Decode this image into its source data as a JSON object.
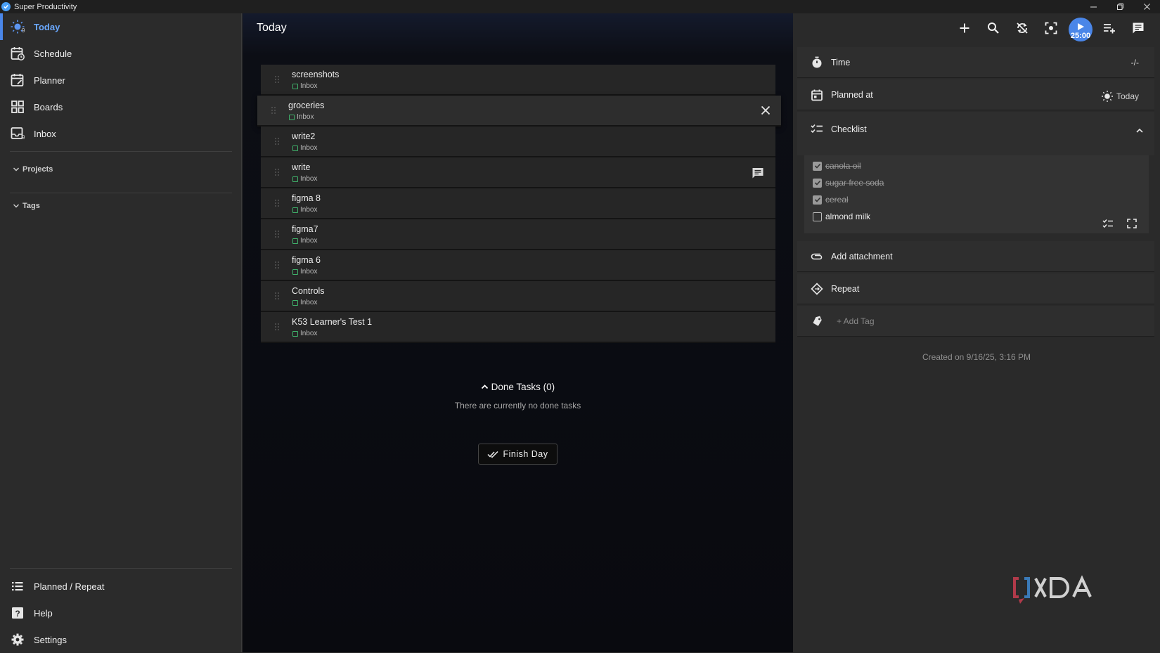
{
  "window": {
    "title": "Super Productivity"
  },
  "sidebar": {
    "nav": [
      {
        "label": "Today",
        "badge": "9",
        "icon": "sun-icon"
      },
      {
        "label": "Schedule",
        "icon": "schedule-icon"
      },
      {
        "label": "Planner",
        "icon": "planner-icon"
      },
      {
        "label": "Boards",
        "icon": "boards-icon"
      },
      {
        "label": "Inbox",
        "badge": "9",
        "icon": "inbox-icon"
      }
    ],
    "sections": {
      "projects": "Projects",
      "tags": "Tags"
    },
    "bottom": [
      {
        "label": "Planned / Repeat",
        "icon": "list-icon"
      },
      {
        "label": "Help",
        "icon": "help-icon"
      },
      {
        "label": "Settings",
        "icon": "gear-icon"
      }
    ]
  },
  "main": {
    "title": "Today",
    "tasks": [
      {
        "title": "screenshots",
        "tag": "Inbox"
      },
      {
        "title": "groceries",
        "tag": "Inbox"
      },
      {
        "title": "write2",
        "tag": "Inbox"
      },
      {
        "title": "write",
        "tag": "Inbox"
      },
      {
        "title": "figma 8",
        "tag": "Inbox"
      },
      {
        "title": "figma7",
        "tag": "Inbox"
      },
      {
        "title": "figma 6",
        "tag": "Inbox"
      },
      {
        "title": "Controls",
        "tag": "Inbox"
      },
      {
        "title": "K53 Learner's Test 1",
        "tag": "Inbox"
      }
    ],
    "done_title": "Done Tasks (0)",
    "done_empty": "There are currently no done tasks",
    "finish_day": "Finish Day"
  },
  "toolbar": {
    "timer": "25:00"
  },
  "detail": {
    "time_label": "Time",
    "time_value": "-/-",
    "planned_label": "Planned at",
    "planned_value": "Today",
    "checklist_label": "Checklist",
    "checklist": [
      {
        "text": "canola oil",
        "done": true
      },
      {
        "text": "sugar free soda",
        "done": true
      },
      {
        "text": "cereal",
        "done": true
      },
      {
        "text": "almond milk",
        "done": false
      }
    ],
    "attachment_label": "Add attachment",
    "repeat_label": "Repeat",
    "add_tag": "+ Add Tag",
    "created": "Created on 9/16/25, 3:16 PM"
  },
  "colors": {
    "accent": "#4a86e8",
    "active_nav": "#6aa8ff",
    "tag_icon": "#3fb06a"
  }
}
